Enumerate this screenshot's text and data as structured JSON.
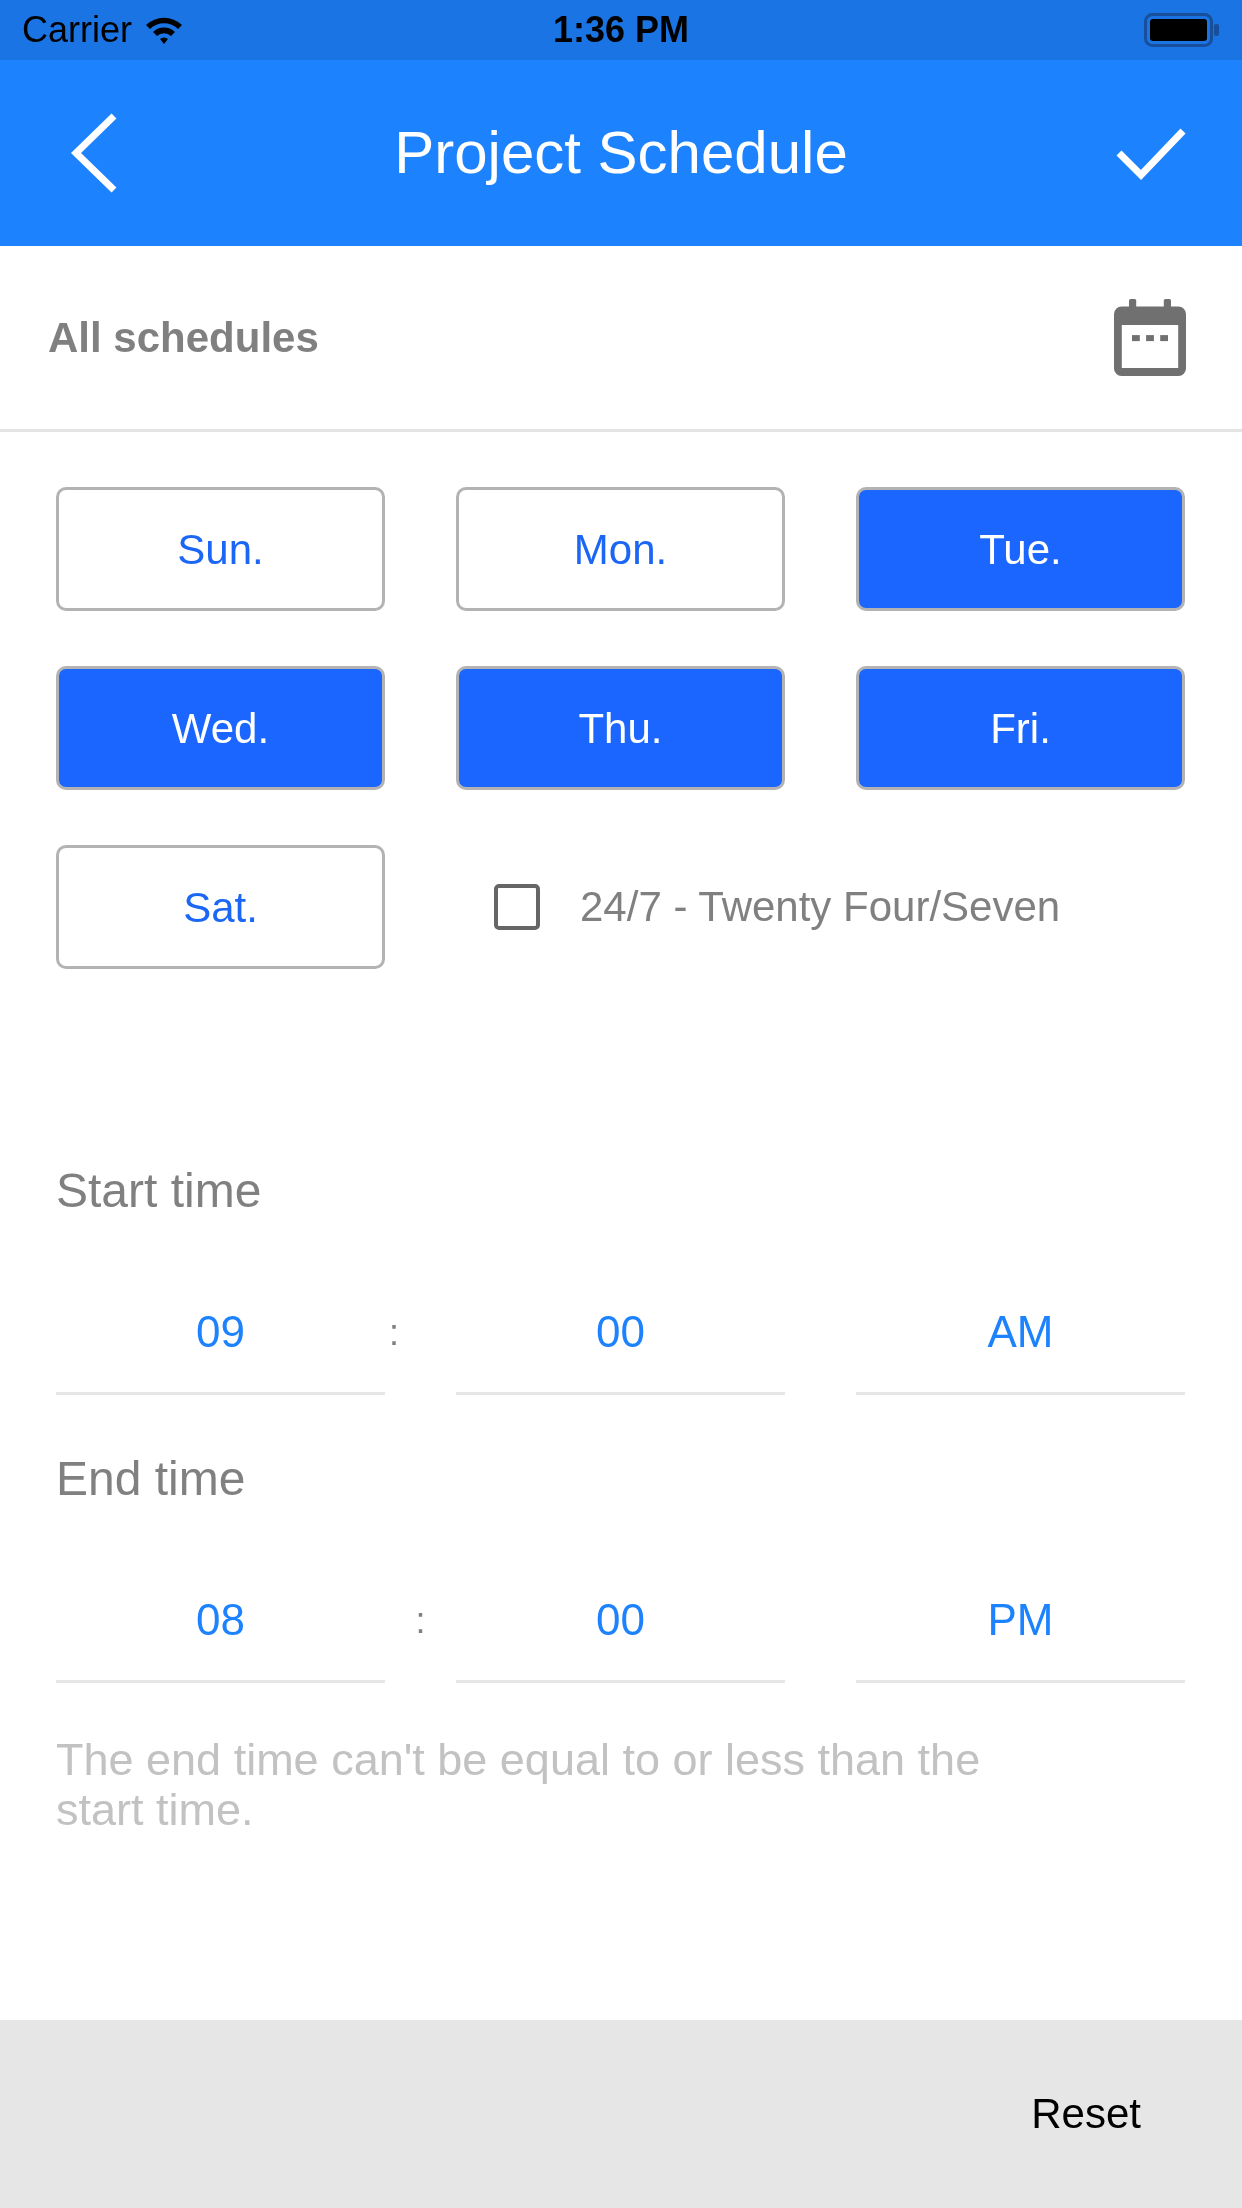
{
  "status_bar": {
    "carrier": "Carrier",
    "time": "1:36 PM"
  },
  "nav_bar": {
    "title": "Project Schedule"
  },
  "schedule_picker": {
    "label": "All schedules"
  },
  "days": [
    {
      "label": "Sun.",
      "selected": false
    },
    {
      "label": "Mon.",
      "selected": false
    },
    {
      "label": "Tue.",
      "selected": true
    },
    {
      "label": "Wed.",
      "selected": true
    },
    {
      "label": "Thu.",
      "selected": true
    },
    {
      "label": "Fri.",
      "selected": true
    },
    {
      "label": "Sat.",
      "selected": false
    }
  ],
  "all_week": {
    "label": "24/7 - Twenty Four/Seven",
    "checked": false
  },
  "times": [
    {
      "label": "Start time",
      "hour": "09",
      "separator": ":",
      "minute": "00",
      "period": "AM"
    },
    {
      "label": "End time",
      "hour": "08",
      "separator": ":",
      "minute": "00",
      "period": "PM"
    }
  ],
  "error_message": "The end time can't be equal to or less than the start time.",
  "footer": {
    "reset": "Reset"
  }
}
